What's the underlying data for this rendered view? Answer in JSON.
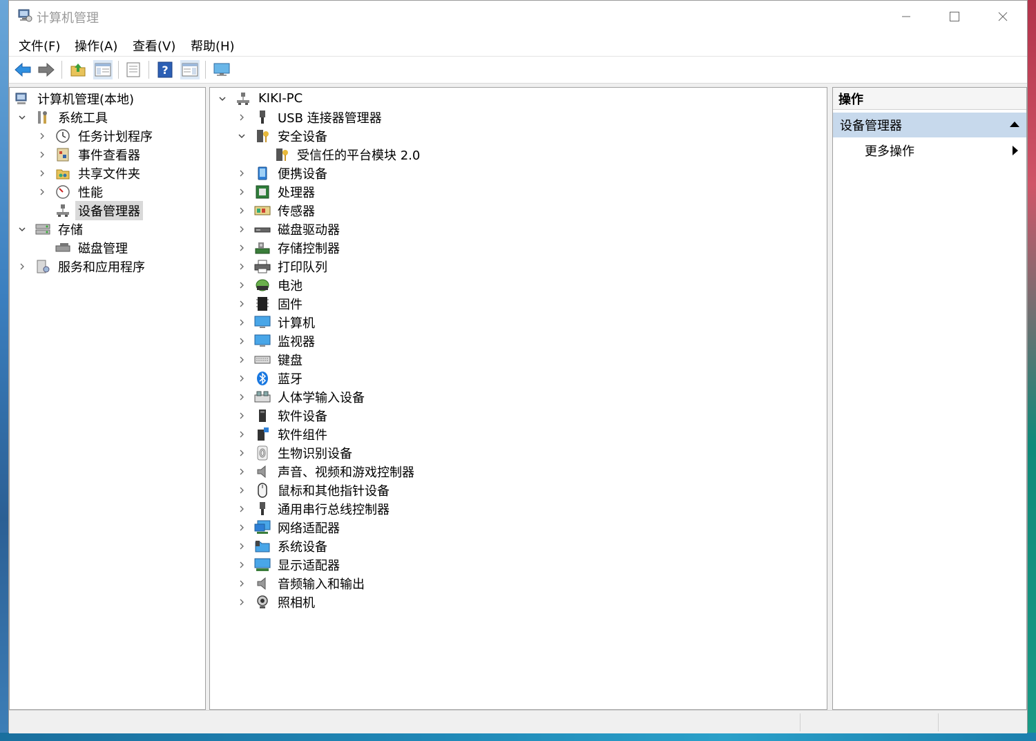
{
  "window": {
    "title": "计算机管理"
  },
  "menu": {
    "items": [
      "文件(F)",
      "操作(A)",
      "查看(V)",
      "帮助(H)"
    ]
  },
  "toolbar": {
    "buttons": [
      "back-icon",
      "forward-icon",
      "up-folder-icon",
      "show-hide-tree-icon",
      "properties-icon",
      "help-icon",
      "show-hide-action-pane-icon",
      "monitor-icon"
    ]
  },
  "left_tree": {
    "root": "计算机管理(本地)",
    "system_tools": "系统工具",
    "task_scheduler": "任务计划程序",
    "event_viewer": "事件查看器",
    "shared_folders": "共享文件夹",
    "performance": "性能",
    "device_manager": "设备管理器",
    "storage": "存储",
    "disk_management": "磁盘管理",
    "services_apps": "服务和应用程序"
  },
  "device_tree": {
    "computer": "KIKI-PC",
    "usb_connector": "USB 连接器管理器",
    "security": "安全设备",
    "tpm": "受信任的平台模块 2.0",
    "portable": "便携设备",
    "processor": "处理器",
    "sensor": "传感器",
    "disk_drive": "磁盘驱动器",
    "storage_ctrl": "存储控制器",
    "print_queue": "打印队列",
    "battery": "电池",
    "firmware": "固件",
    "computer_node": "计算机",
    "monitor": "监视器",
    "keyboard": "键盘",
    "bluetooth": "蓝牙",
    "hid": "人体学输入设备",
    "software_device": "软件设备",
    "software_component": "软件组件",
    "biometric": "生物识别设备",
    "sound": "声音、视频和游戏控制器",
    "mouse": "鼠标和其他指针设备",
    "usb_ctrl": "通用串行总线控制器",
    "network": "网络适配器",
    "system_dev": "系统设备",
    "display": "显示适配器",
    "audio_io": "音频输入和输出",
    "camera": "照相机"
  },
  "actions": {
    "header": "操作",
    "section": "设备管理器",
    "more": "更多操作"
  }
}
